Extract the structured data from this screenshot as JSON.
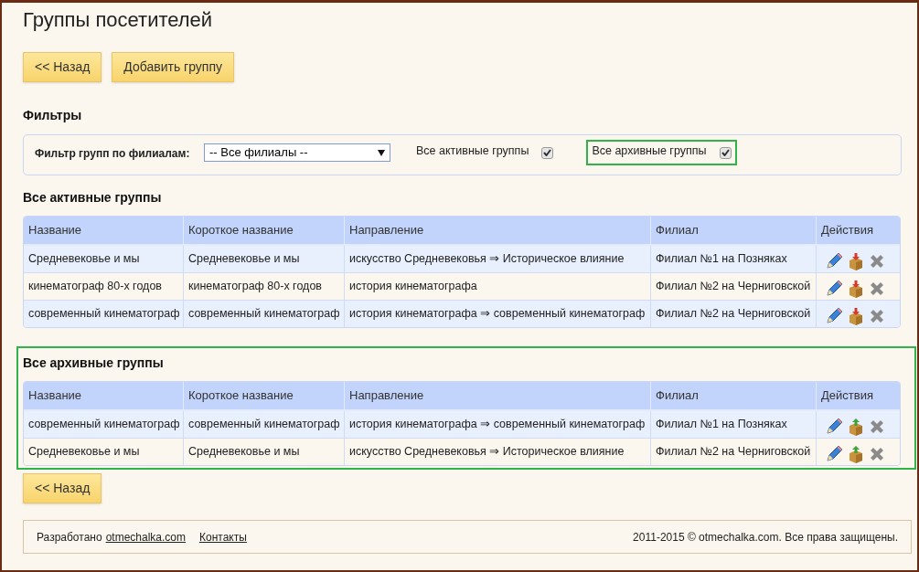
{
  "title": "Группы посетителей",
  "top_buttons": [
    "<< Назад",
    "Добавить группу"
  ],
  "filters": {
    "heading": "Фильтры",
    "branch_label": "Фильтр групп по филиалам:",
    "branch_value": "-- Все филиалы --",
    "checkboxes": [
      {
        "label": "Все активные группы",
        "checked": true,
        "highlighted": false
      },
      {
        "label": "Все архивные группы",
        "checked": true,
        "highlighted": true
      }
    ]
  },
  "sections": [
    {
      "heading": "Все активные группы",
      "archived": false,
      "highlighted": false,
      "columns": [
        "Название",
        "Короткое название",
        "Направление",
        "Филиал",
        "Действия"
      ],
      "rows": [
        [
          "Средневековье и мы",
          "Средневековье и мы",
          "искусство Средневековья ⇒ Историческое влияние",
          "Филиал №1 на Позняках"
        ],
        [
          "кинематограф 80-х годов",
          "кинематограф 80-х годов",
          "история кинематографа",
          "Филиал №2 на Черниговской"
        ],
        [
          "современный кинематограф",
          "современный кинематограф",
          "история кинематографа ⇒ современный кинематограф",
          "Филиал №2 на Черниговской"
        ]
      ]
    },
    {
      "heading": "Все архивные группы",
      "archived": true,
      "highlighted": true,
      "columns": [
        "Название",
        "Короткое название",
        "Направление",
        "Филиал",
        "Действия"
      ],
      "rows": [
        [
          "современный кинематограф",
          "современный кинематограф",
          "история кинематографа ⇒ современный кинематограф",
          "Филиал №1 на Позняках"
        ],
        [
          "Средневековье и мы",
          "Средневековье и мы",
          "искусство Средневековья ⇒ Историческое влияние",
          "Филиал №2 на Черниговской"
        ]
      ]
    }
  ],
  "bottom_button": "<< Назад",
  "footer": {
    "prefix": "Разработано",
    "link": "otmechalka.com",
    "contacts": "Контакты",
    "copyright": "2011-2015 © otmechalka.com. Все права защищены."
  }
}
